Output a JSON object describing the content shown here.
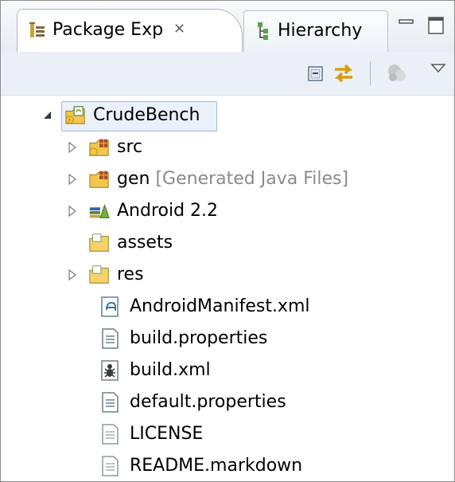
{
  "tabs": {
    "active_label": "Package Exp",
    "close_glyph": "✕",
    "inactive_label": "Hierarchy"
  },
  "tree": {
    "project": "CrudeBench",
    "items": [
      {
        "label": "src",
        "decoration": ""
      },
      {
        "label": "gen",
        "decoration": "[Generated Java Files]"
      },
      {
        "label": "Android 2.2",
        "decoration": ""
      },
      {
        "label": "assets",
        "decoration": ""
      },
      {
        "label": "res",
        "decoration": ""
      },
      {
        "label": "AndroidManifest.xml",
        "decoration": ""
      },
      {
        "label": "build.properties",
        "decoration": ""
      },
      {
        "label": "build.xml",
        "decoration": ""
      },
      {
        "label": "default.properties",
        "decoration": ""
      },
      {
        "label": "LICENSE",
        "decoration": ""
      },
      {
        "label": "README.markdown",
        "decoration": ""
      }
    ]
  },
  "icons": {
    "tab_package": "package-explorer-icon",
    "tab_hierarchy": "hierarchy-icon",
    "minimize": "minimize-icon",
    "maximize": "maximize-icon",
    "collapse_all": "collapse-all-icon",
    "link_editor": "link-with-editor-icon",
    "focus": "focus-active-task-icon",
    "view_menu": "view-menu-icon"
  }
}
